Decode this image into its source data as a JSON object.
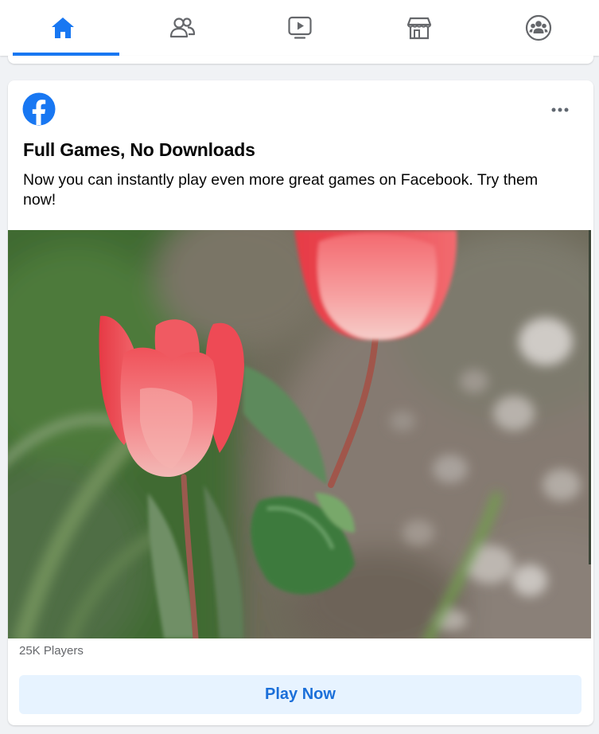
{
  "nav": {
    "tabs": [
      {
        "icon": "home-icon",
        "active": true
      },
      {
        "icon": "friends-icon",
        "active": false
      },
      {
        "icon": "watch-icon",
        "active": false
      },
      {
        "icon": "marketplace-icon",
        "active": false
      },
      {
        "icon": "groups-icon",
        "active": false
      }
    ],
    "active_color": "#1877f2",
    "inactive_color": "#65676b"
  },
  "ad": {
    "logo_icon": "facebook-logo-icon",
    "more_icon": "more-options-icon",
    "title": "Full Games, No Downloads",
    "body": "Now you can instantly play even more great games on Facebook. Try them now!",
    "image_icon": "tulip-photo",
    "players": "25K Players",
    "cta_label": "Play Now",
    "cta_color": "#1b6fd9",
    "cta_bg": "#e7f3ff"
  }
}
